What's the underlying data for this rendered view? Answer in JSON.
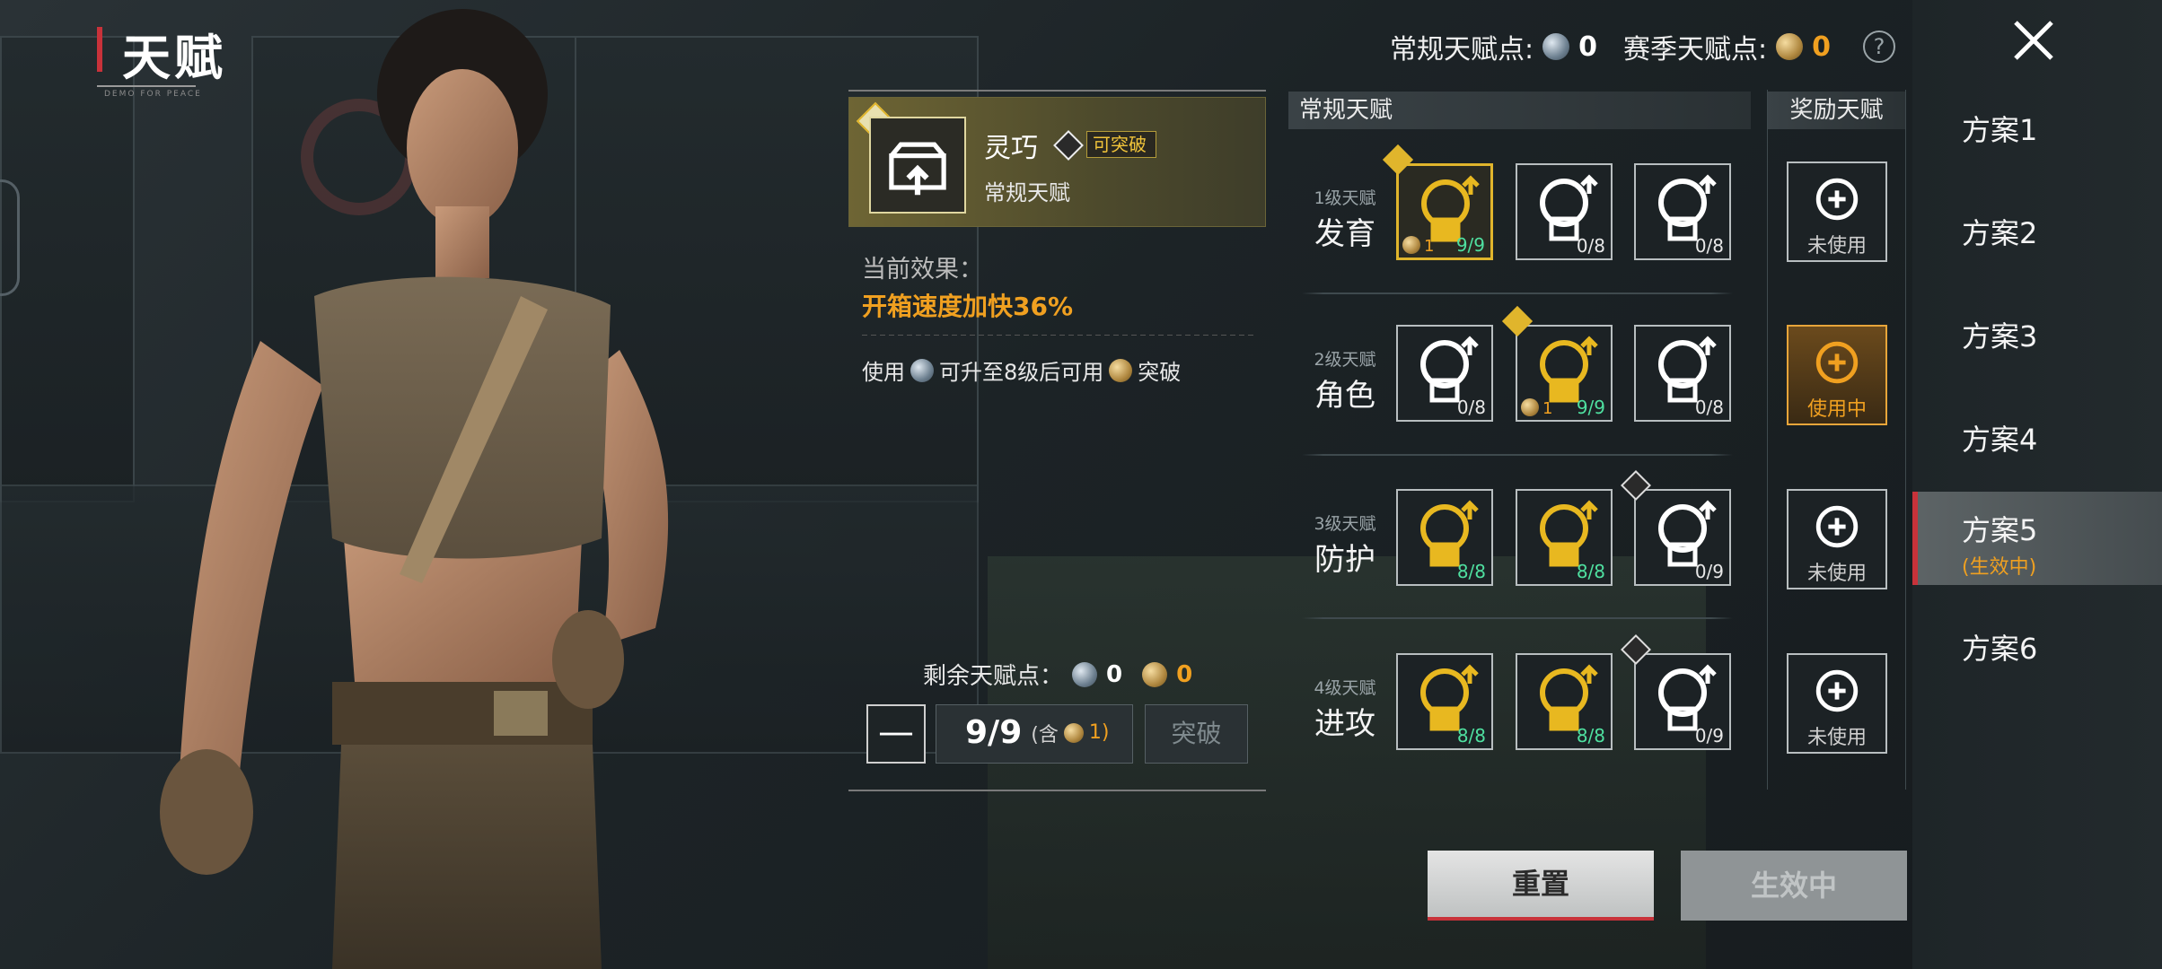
{
  "page_title": "天赋",
  "watermark_small": "DEMO FOR PEACE",
  "header": {
    "normal_points_label": "常规天赋点:",
    "normal_points_value": "0",
    "season_points_label": "赛季天赋点:",
    "season_points_value": "0",
    "help_glyph": "?"
  },
  "detail": {
    "name": "灵巧",
    "badge": "可突破",
    "category": "常规天赋",
    "current_effect_label": "当前效果：",
    "current_effect_value": "开箱速度加快36%",
    "usage_pre": "使用",
    "usage_mid": "可升至8级后可用",
    "usage_post": "突破",
    "remaining_label": "剩余天赋点：",
    "remaining_normal": "0",
    "remaining_season": "0",
    "count_main": "9/9",
    "count_paren_open": "(含",
    "count_paren_val": "1)",
    "minus_label": "—",
    "break_label": "突破"
  },
  "sections": {
    "normal_title": "常规天赋",
    "reward_title": "奖励天赋"
  },
  "tiers": [
    {
      "level": "1级天赋",
      "name": "发育",
      "slots": [
        {
          "icon": "supply-box-upgrade-icon",
          "count": "9/9",
          "bonus": "1",
          "state": "selected"
        },
        {
          "icon": "open-crate-icon",
          "count": "0/8",
          "state": "normal"
        },
        {
          "icon": "sprint-runner-icon",
          "count": "0/8",
          "state": "normal"
        }
      ]
    },
    {
      "level": "2级天赋",
      "name": "角色",
      "slots": [
        {
          "icon": "sound-soldier-icon",
          "count": "0/8",
          "state": "normal"
        },
        {
          "icon": "running-soldier-icon",
          "count": "9/9",
          "bonus": "1",
          "state": "gold"
        },
        {
          "icon": "backpack-upgrade-icon",
          "count": "0/8",
          "state": "normal"
        }
      ]
    },
    {
      "level": "3级天赋",
      "name": "防护",
      "slots": [
        {
          "icon": "muscle-armor-icon",
          "count": "8/8",
          "state": "gold"
        },
        {
          "icon": "vest-upgrade-icon",
          "count": "8/8",
          "state": "gold"
        },
        {
          "icon": "glove-icon",
          "count": "0/9",
          "state": "normal"
        }
      ]
    },
    {
      "level": "4级天赋",
      "name": "进攻",
      "slots": [
        {
          "icon": "rifle-fire-icon",
          "count": "8/8",
          "state": "gold"
        },
        {
          "icon": "gun-reload-icon",
          "count": "8/8",
          "state": "gold"
        },
        {
          "icon": "armor-break-icon",
          "count": "0/9",
          "state": "normal"
        }
      ]
    }
  ],
  "rewards": [
    {
      "icon": "bag-drop-icon",
      "status": "未使用"
    },
    {
      "icon": "strongman-icon",
      "status": "使用中"
    },
    {
      "icon": "parachute-supply-icon",
      "status": "未使用"
    },
    {
      "icon": "bullet-icon",
      "status": "未使用"
    }
  ],
  "buttons": {
    "reset": "重置",
    "active": "生效中"
  },
  "plans": [
    {
      "label": "方案1"
    },
    {
      "label": "方案2"
    },
    {
      "label": "方案3"
    },
    {
      "label": "方案4"
    },
    {
      "label": "方案5",
      "sub": "(生效中)"
    },
    {
      "label": "方案6"
    }
  ],
  "colors": {
    "accent_red": "#c8323a",
    "gold": "#e0b52c",
    "orange": "#f0a020",
    "teal_count": "#4fe0a0"
  }
}
